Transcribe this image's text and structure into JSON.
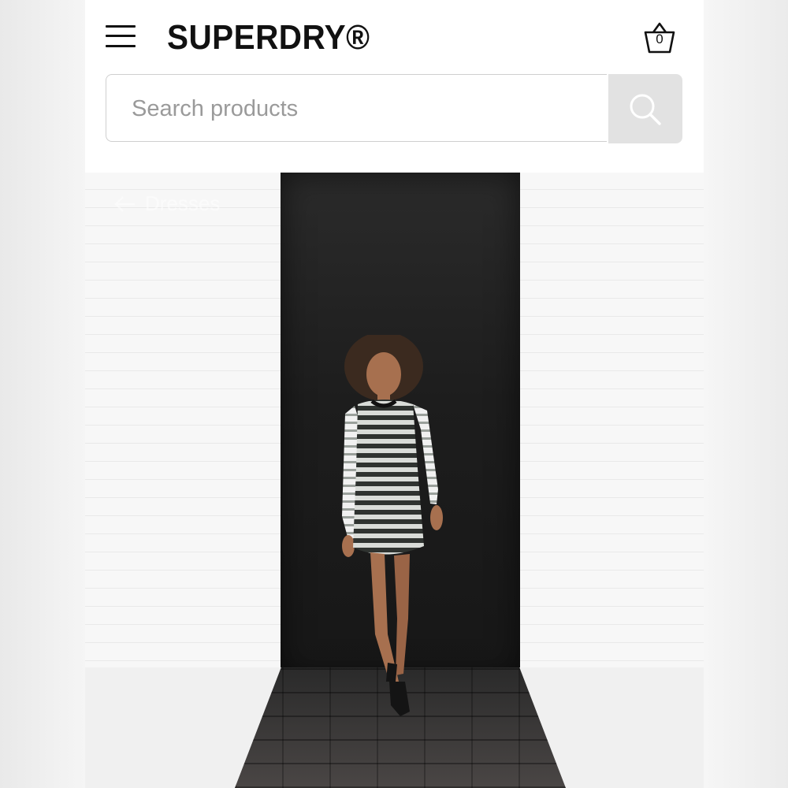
{
  "header": {
    "brand": "SUPERDRY®",
    "basket_count": "0"
  },
  "search": {
    "placeholder": "Search products"
  },
  "hero": {
    "breadcrumb_label": "Dresses",
    "image_description_icon": "model-photo"
  },
  "icons": {
    "menu": "hamburger-icon",
    "basket": "basket-icon",
    "search": "search-icon",
    "back": "arrow-left-icon"
  },
  "colors": {
    "background": "#ffffff",
    "text": "#111111",
    "search_button": "#e2e2e2",
    "placeholder": "#9a9a9a"
  }
}
